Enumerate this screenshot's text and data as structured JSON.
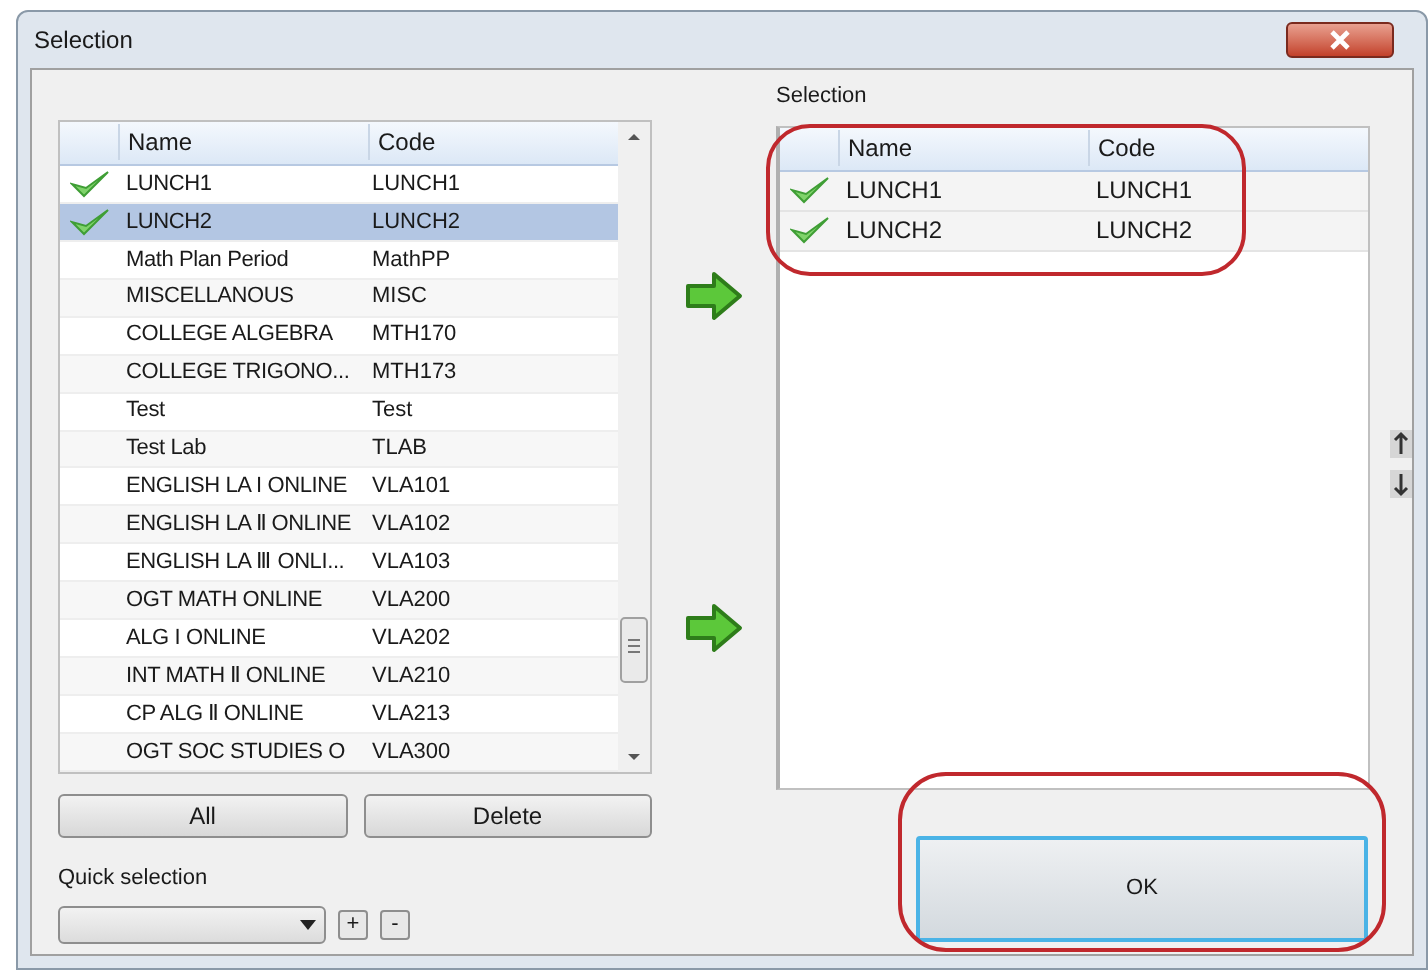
{
  "window": {
    "title": "Selection"
  },
  "available": {
    "columns": [
      "Name",
      "Code"
    ],
    "rows": [
      {
        "name": "LUNCH1",
        "code": "LUNCH1",
        "checked": true,
        "selected": false
      },
      {
        "name": "LUNCH2",
        "code": "LUNCH2",
        "checked": true,
        "selected": true
      },
      {
        "name": "Math Plan Period",
        "code": "MathPP",
        "checked": false,
        "selected": false
      },
      {
        "name": "MISCELLANOUS",
        "code": "MISC",
        "checked": false,
        "selected": false
      },
      {
        "name": "COLLEGE ALGEBRA",
        "code": "MTH170",
        "checked": false,
        "selected": false
      },
      {
        "name": "COLLEGE TRIGONO...",
        "code": "MTH173",
        "checked": false,
        "selected": false
      },
      {
        "name": "Test",
        "code": "Test",
        "checked": false,
        "selected": false
      },
      {
        "name": "Test Lab",
        "code": "TLAB",
        "checked": false,
        "selected": false
      },
      {
        "name": "ENGLISH LA I ONLINE",
        "code": "VLA101",
        "checked": false,
        "selected": false
      },
      {
        "name": "ENGLISH LA Ⅱ ONLINE",
        "code": "VLA102",
        "checked": false,
        "selected": false
      },
      {
        "name": "ENGLISH LA Ⅲ ONLI...",
        "code": "VLA103",
        "checked": false,
        "selected": false
      },
      {
        "name": "OGT MATH ONLINE",
        "code": "VLA200",
        "checked": false,
        "selected": false
      },
      {
        "name": "ALG I ONLINE",
        "code": "VLA202",
        "checked": false,
        "selected": false
      },
      {
        "name": "INT MATH Ⅱ ONLINE",
        "code": "VLA210",
        "checked": false,
        "selected": false
      },
      {
        "name": "CP ALG Ⅱ ONLINE",
        "code": "VLA213",
        "checked": false,
        "selected": false
      },
      {
        "name": "OGT SOC STUDIES O",
        "code": "VLA300",
        "checked": false,
        "selected": false
      }
    ]
  },
  "buttons": {
    "all": "All",
    "delete": "Delete",
    "ok": "OK"
  },
  "quick_selection": {
    "label": "Quick selection",
    "add": "+",
    "remove": "-"
  },
  "selection": {
    "label": "Selection",
    "columns": [
      "Name",
      "Code"
    ],
    "rows": [
      {
        "name": "LUNCH1",
        "code": "LUNCH1",
        "checked": true
      },
      {
        "name": "LUNCH2",
        "code": "LUNCH2",
        "checked": true
      }
    ]
  }
}
